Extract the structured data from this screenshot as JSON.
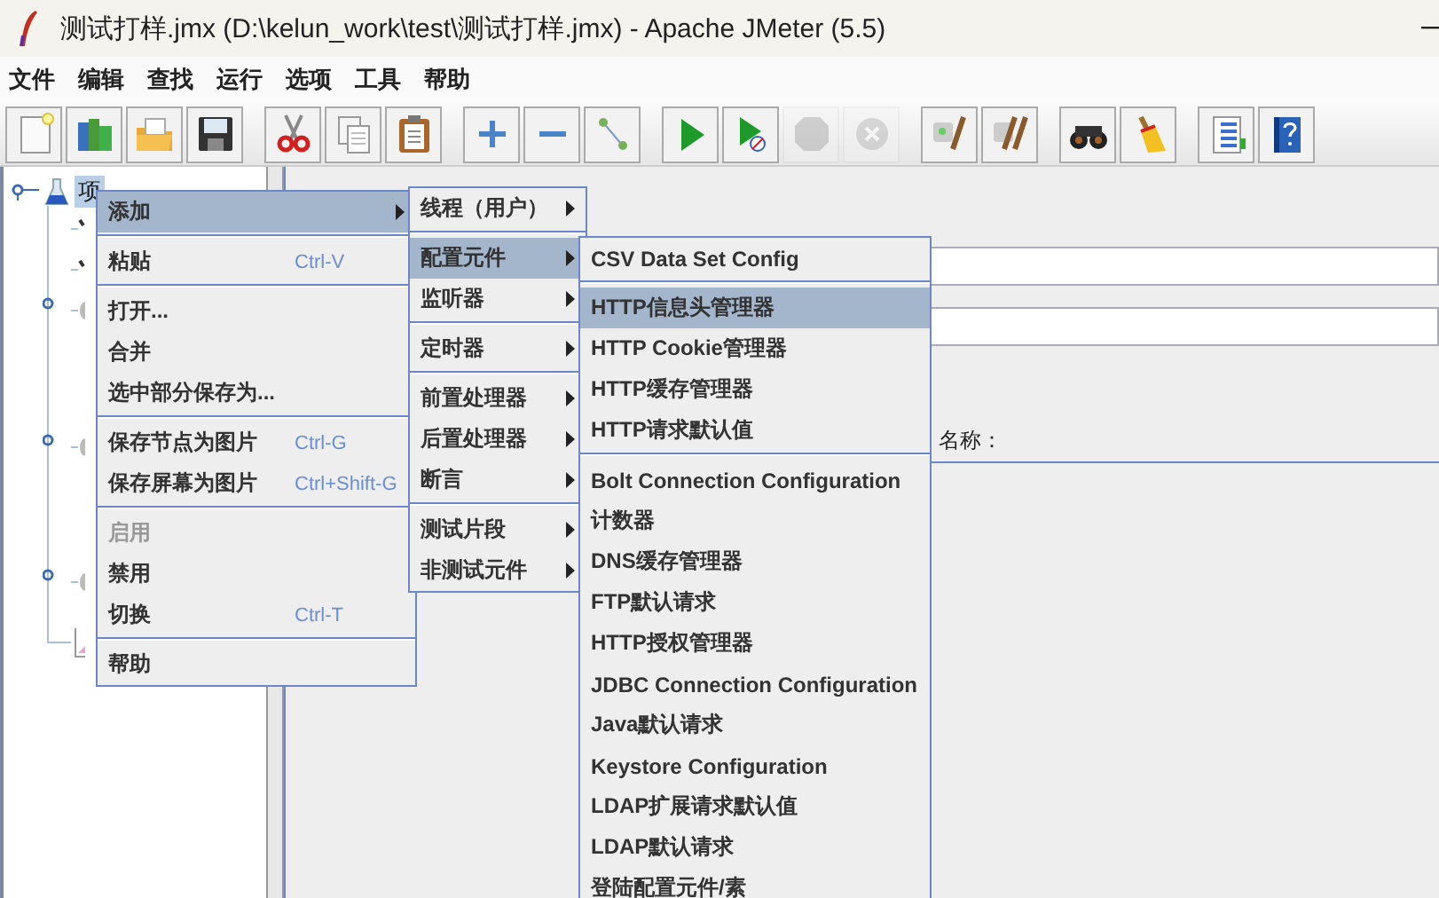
{
  "window": {
    "title": "测试打样.jmx (D:\\kelun_work\\test\\测试打样.jmx) - Apache JMeter (5.5)"
  },
  "menubar": [
    "文件",
    "编辑",
    "查找",
    "运行",
    "选项",
    "工具",
    "帮助"
  ],
  "toolbar": [
    [
      {
        "disabled": false
      },
      {
        "disabled": false
      },
      {
        "disabled": false
      },
      {
        "disabled": false
      }
    ],
    [
      {
        "disabled": false
      },
      {
        "disabled": false
      },
      {
        "disabled": false
      }
    ],
    [
      {
        "disabled": false
      },
      {
        "disabled": false
      },
      {
        "disabled": false
      }
    ],
    [
      {
        "disabled": false
      },
      {
        "disabled": false
      },
      {
        "disabled": true
      },
      {
        "disabled": true
      }
    ],
    [
      {
        "disabled": false
      },
      {
        "disabled": false
      }
    ],
    [
      {
        "disabled": false
      },
      {
        "disabled": false
      }
    ],
    [
      {
        "disabled": false
      },
      {
        "disabled": false
      }
    ]
  ],
  "tree": {
    "root": {
      "label": "项",
      "selected": true
    }
  },
  "panel": {
    "name_label": "名称："
  },
  "menus": [
    {
      "items": [
        {
          "kind": "item",
          "label": "添加",
          "submenu": true,
          "selected": true,
          "disabled": false
        },
        {
          "kind": "separator"
        },
        {
          "kind": "item",
          "label": "粘贴",
          "shortcut": "Ctrl-V",
          "submenu": false,
          "selected": false,
          "disabled": false
        },
        {
          "kind": "separator"
        },
        {
          "kind": "item",
          "label": "打开...",
          "submenu": false,
          "selected": false,
          "disabled": false
        },
        {
          "kind": "item",
          "label": "合并",
          "submenu": false,
          "selected": false,
          "disabled": false
        },
        {
          "kind": "item",
          "label": "选中部分保存为...",
          "submenu": false,
          "selected": false,
          "disabled": false
        },
        {
          "kind": "separator"
        },
        {
          "kind": "item",
          "label": "保存节点为图片",
          "shortcut": "Ctrl-G",
          "submenu": false,
          "selected": false,
          "disabled": false
        },
        {
          "kind": "item",
          "label": "保存屏幕为图片",
          "shortcut": "Ctrl+Shift-G",
          "submenu": false,
          "selected": false,
          "disabled": false
        },
        {
          "kind": "separator"
        },
        {
          "kind": "item",
          "label": "启用",
          "submenu": false,
          "selected": false,
          "disabled": true
        },
        {
          "kind": "item",
          "label": "禁用",
          "submenu": false,
          "selected": false,
          "disabled": false
        },
        {
          "kind": "item",
          "label": "切换",
          "shortcut": "Ctrl-T",
          "submenu": false,
          "selected": false,
          "disabled": false
        },
        {
          "kind": "separator"
        },
        {
          "kind": "item",
          "label": "帮助",
          "submenu": false,
          "selected": false,
          "disabled": false
        }
      ]
    },
    {
      "items": [
        {
          "kind": "item",
          "label": "线程（用户）",
          "submenu": true,
          "selected": false
        },
        {
          "kind": "separator"
        },
        {
          "kind": "item",
          "label": "配置元件",
          "submenu": true,
          "selected": true
        },
        {
          "kind": "item",
          "label": "监听器",
          "submenu": true,
          "selected": false
        },
        {
          "kind": "separator"
        },
        {
          "kind": "item",
          "label": "定时器",
          "submenu": true,
          "selected": false
        },
        {
          "kind": "separator"
        },
        {
          "kind": "item",
          "label": "前置处理器",
          "submenu": true,
          "selected": false
        },
        {
          "kind": "item",
          "label": "后置处理器",
          "submenu": true,
          "selected": false
        },
        {
          "kind": "item",
          "label": "断言",
          "submenu": true,
          "selected": false
        },
        {
          "kind": "separator"
        },
        {
          "kind": "item",
          "label": "测试片段",
          "submenu": true,
          "selected": false
        },
        {
          "kind": "item",
          "label": "非测试元件",
          "submenu": true,
          "selected": false
        }
      ]
    },
    {
      "items": [
        {
          "kind": "item",
          "label": "CSV Data Set Config",
          "selected": false
        },
        {
          "kind": "separator"
        },
        {
          "kind": "item",
          "label": "HTTP信息头管理器",
          "selected": true
        },
        {
          "kind": "item",
          "label": "HTTP Cookie管理器",
          "selected": false
        },
        {
          "kind": "item",
          "label": "HTTP缓存管理器",
          "selected": false
        },
        {
          "kind": "item",
          "label": "HTTP请求默认值",
          "selected": false
        },
        {
          "kind": "separator"
        },
        {
          "kind": "item",
          "label": "Bolt Connection Configuration",
          "selected": false
        },
        {
          "kind": "item",
          "label": "计数器",
          "selected": false
        },
        {
          "kind": "item",
          "label": "DNS缓存管理器",
          "selected": false
        },
        {
          "kind": "item",
          "label": "FTP默认请求",
          "selected": false
        },
        {
          "kind": "item",
          "label": "HTTP授权管理器",
          "selected": false
        },
        {
          "kind": "item",
          "label": "JDBC Connection Configuration",
          "selected": false
        },
        {
          "kind": "item",
          "label": "Java默认请求",
          "selected": false
        },
        {
          "kind": "item",
          "label": "Keystore Configuration",
          "selected": false
        },
        {
          "kind": "item",
          "label": "LDAP扩展请求默认值",
          "selected": false
        },
        {
          "kind": "item",
          "label": "LDAP默认请求",
          "selected": false
        },
        {
          "kind": "item",
          "label": "登陆配置元件/素",
          "selected": false
        }
      ]
    }
  ]
}
